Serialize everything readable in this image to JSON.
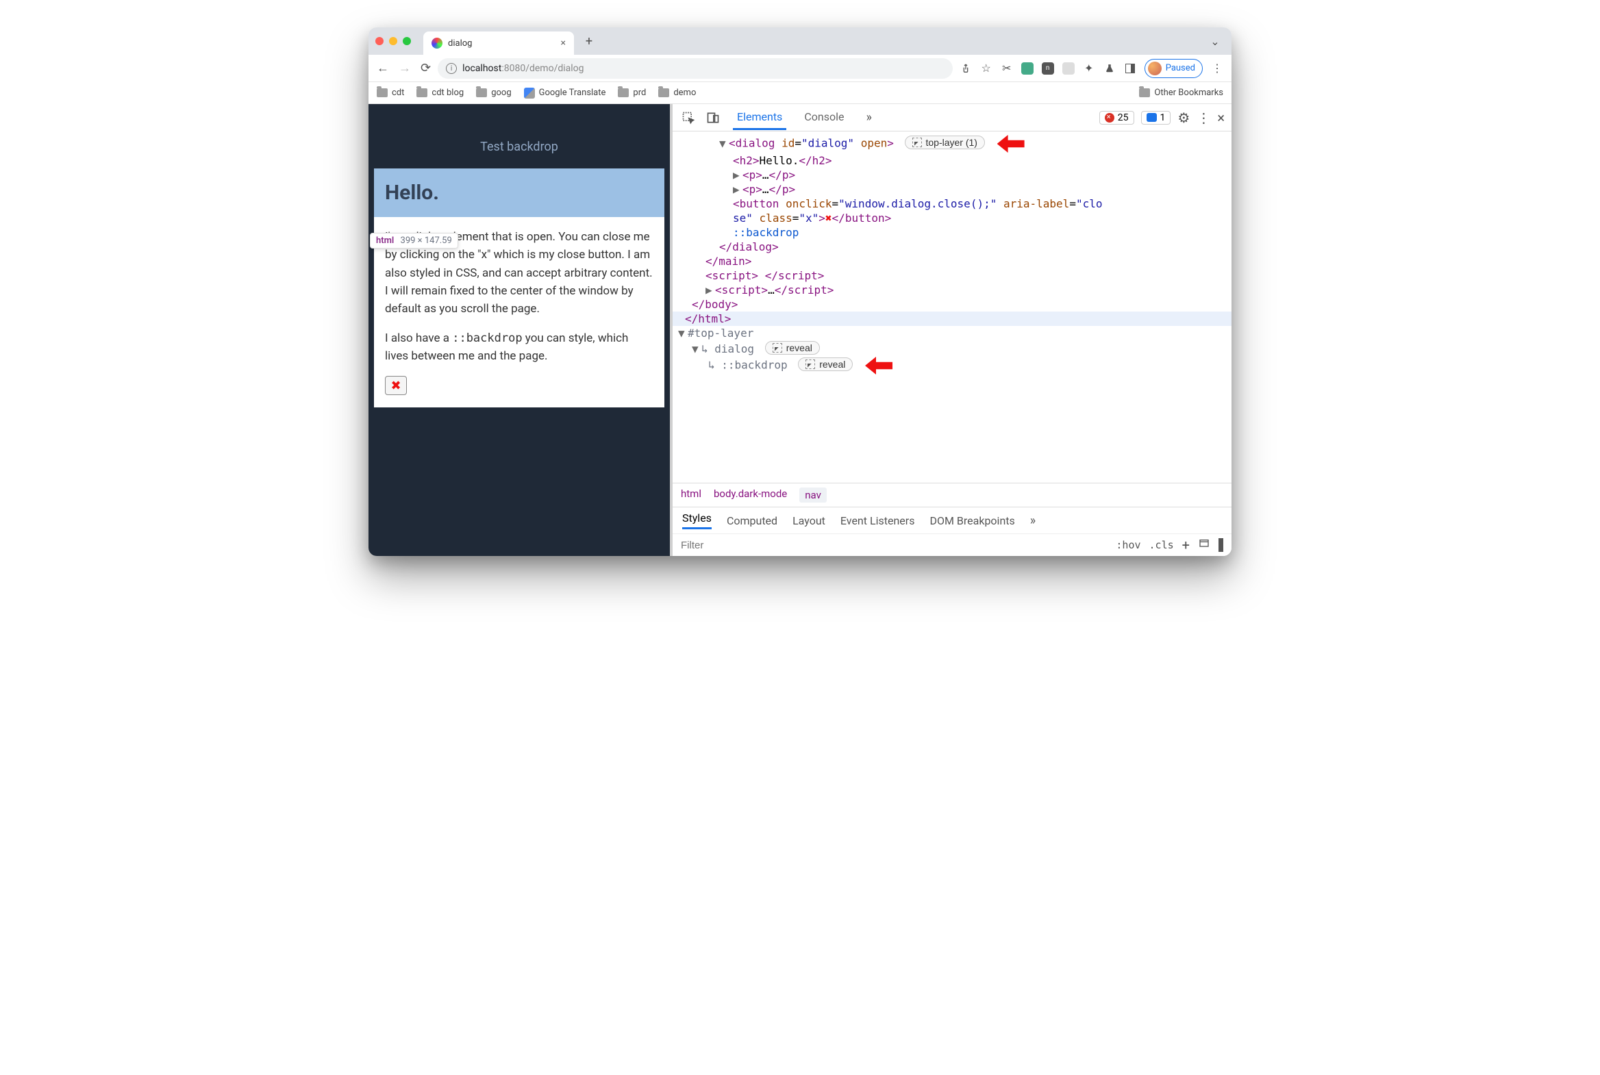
{
  "tab": {
    "title": "dialog"
  },
  "toolbar": {
    "url_host": "localhost",
    "url_rest": ":8080/demo/dialog",
    "profile_label": "Paused"
  },
  "bookmarks": {
    "items": [
      "cdt",
      "cdt blog",
      "goog",
      "Google Translate",
      "prd",
      "demo"
    ],
    "other": "Other Bookmarks"
  },
  "page": {
    "backdrop_button": "Test backdrop",
    "dialog_title": "Hello.",
    "p1": "I'm a dialog element that is open. You can close me by clicking on the \"x\" which is my close button. I am also styled in CSS, and can accept arbitrary content. I will remain fixed to the center of the window by default as you scroll the page.",
    "p2a": "I also have a ",
    "p2code": "::backdrop",
    "p2b": " you can style, which lives between me and the page.",
    "inspect_selector": "html",
    "inspect_dims": "399 × 147.59"
  },
  "devtools": {
    "tabs": {
      "elements": "Elements",
      "console": "Console"
    },
    "errors": "25",
    "messages": "1",
    "top_layer_badge": "top-layer (1)",
    "reveal": "reveal",
    "dom": {
      "dialog_open": "<dialog id=\"dialog\" open>",
      "h2": "<h2>Hello.</h2>",
      "p_collapsed": "<p>…</p>",
      "button_l1": "<button onclick=\"window.dialog.close();\" aria-label=\"clo",
      "button_l2": "se\" class=\"x\">",
      "button_close": "</button>",
      "backdrop": "::backdrop",
      "dialog_close": "</dialog>",
      "main_close": "</main>",
      "script1": "<script> </script>",
      "script2": "<script>…</script>",
      "body_close": "</body>",
      "html_close": "</html>",
      "top_layer": "#top-layer",
      "tl_dialog": "↳ dialog",
      "tl_backdrop": "↳ ::backdrop"
    },
    "crumbs": {
      "a": "html",
      "b": "body.dark-mode",
      "c": "nav"
    },
    "styles_tabs": {
      "styles": "Styles",
      "computed": "Computed",
      "layout": "Layout",
      "listeners": "Event Listeners",
      "dom_bp": "DOM Breakpoints"
    },
    "filter_placeholder": "Filter",
    "hov": ":hov",
    "cls": ".cls"
  }
}
